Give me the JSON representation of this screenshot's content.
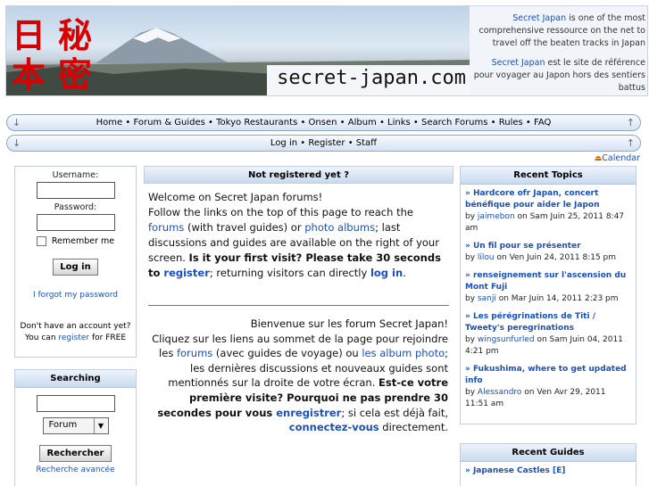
{
  "banner": {
    "kanji": [
      "日",
      "秘",
      "本",
      "密"
    ],
    "domain": "secret-japan.com",
    "desc_en": {
      "link": "Secret Japan",
      "text": " is one of the most comprehensive ressource on the net to travel off the beaten tracks in Japan"
    },
    "desc_fr": {
      "link": "Secret Japan",
      "text": " est le site de référence pour voyager au Japon hors des sentiers battus"
    }
  },
  "nav": {
    "row1": [
      "Home",
      "Forum & Guides",
      "Tokyo Restaurants",
      "Onsen",
      "Album",
      "Links",
      "Search Forums",
      "Rules",
      "FAQ"
    ],
    "row2": [
      "Log in",
      "Register",
      "Staff"
    ],
    "separator": " • ",
    "calendar": "Calendar"
  },
  "login": {
    "username_label": "Username:",
    "password_label": "Password:",
    "remember": "Remember me",
    "button": "Log in",
    "forgot": "I forgot my password",
    "no_account": "Don't have an account yet?",
    "you_can": "You can ",
    "register": "register",
    "for_free": " for FREE"
  },
  "search": {
    "header": "Searching",
    "select_value": "Forum",
    "button": "Rechercher",
    "advanced": "Recherche avancée"
  },
  "center": {
    "header": "Not registered yet ?",
    "en": {
      "p1": "Welcome on Secret Japan forums!",
      "p2a": "Follow the links on the top of this page to reach the ",
      "forums": "forums",
      "p2b": " (with travel guides) or ",
      "albums": "photo albums",
      "p2c": "; last discussions and guides are available on the right of your screen. ",
      "first_visit": "Is it your first visit? Please take 30 seconds to ",
      "register": "register",
      "p2d": "; returning visitors can directly ",
      "login": "log in",
      "end": "."
    },
    "fr": {
      "p1": "Bienvenue sur les forum Secret Japan!",
      "p2a": "Cliquez sur les liens au sommet de la page pour rejoindre les ",
      "forums": "forums",
      "p2b": " (avec guides de voyage) ou ",
      "albums": "les album photo",
      "p2c": "; les dernières discussions et nouveaux guides sont mentionnés sur la droite de votre écran. ",
      "first_visit": "Est-ce votre première visite? Pourquoi ne pas prendre 30 secondes pour vous ",
      "register": "enregistrer",
      "p2d": "; si cela est déjà fait, ",
      "login": "connectez-vous",
      "end": " directement."
    }
  },
  "recent_topics": {
    "header": "Recent Topics",
    "by": "by ",
    "on": " on ",
    "items": [
      {
        "title": "» Hardcore ofr Japan, concert bénéfique pour aider le Japon",
        "author": "jaimebon",
        "date": "Sam Juin 25, 2011 8:47 am"
      },
      {
        "title": "» Un fil pour se présenter",
        "author": "lilou",
        "date": "Ven Juin 24, 2011 8:15 pm"
      },
      {
        "title": "» renseignement sur l'ascension du Mont Fuji",
        "author": "sanji",
        "date": "Mar Juin 14, 2011 2:23 pm"
      },
      {
        "title": "» Les pérégrinations de Titi / Tweety's peregrinations",
        "author": "wingsunfurled",
        "date": "Sam Juin 04, 2011 4:21 pm"
      },
      {
        "title": "» Fukushima, where to get updated info",
        "author": "Alessandro",
        "date": "Ven Avr 29, 2011 11:51 am"
      }
    ]
  },
  "recent_guides": {
    "header": "Recent Guides",
    "items": [
      {
        "title": "» Japanese Castles [E]"
      }
    ]
  },
  "colors": {
    "link": "#1a4fc4",
    "kanji": "#d80000",
    "header_gradient": "#c9daef"
  }
}
